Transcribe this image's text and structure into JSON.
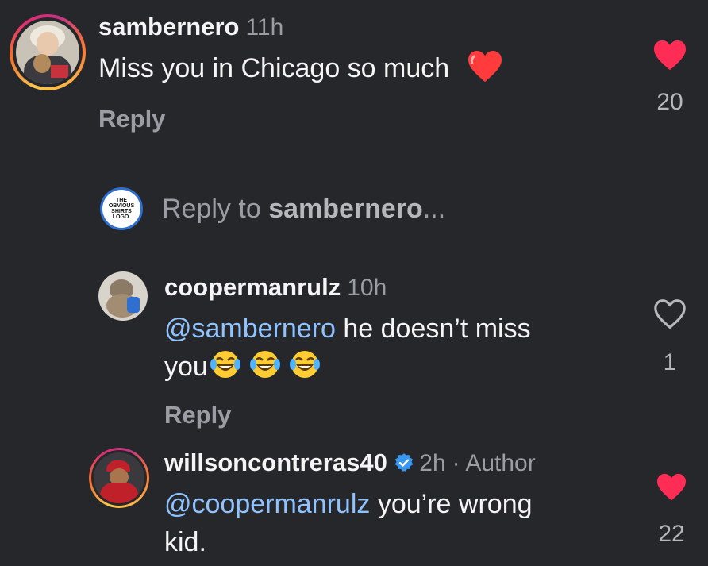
{
  "comments": [
    {
      "username": "sambernero",
      "time": "11h",
      "text": "Miss you in Chicago so much",
      "reply_label": "Reply",
      "likes": "20",
      "liked": true
    },
    {
      "username": "coopermanrulz",
      "time": "10h",
      "mention": "@sambernero",
      "text_1": " he doesn’t miss",
      "text_2": "you",
      "reply_label": "Reply",
      "likes": "1",
      "liked": false
    },
    {
      "username": "willsoncontreras40",
      "time": "2h",
      "author_label": "· Author",
      "mention": "@coopermanrulz",
      "text_1": " you’re wrong",
      "text_2": "kid.",
      "likes": "22",
      "liked": true
    }
  ],
  "reply_box": {
    "placeholder_prefix": "Reply to ",
    "placeholder_user": "sambernero",
    "placeholder_suffix": "...",
    "logo_text": [
      "THE",
      "OBVIOUS",
      "SHIRTS",
      "LOGO."
    ]
  },
  "colors": {
    "background": "#25272b",
    "heart_liked": "#ff2d55",
    "mention": "#8fc3ff",
    "verified": "#3897f0"
  }
}
